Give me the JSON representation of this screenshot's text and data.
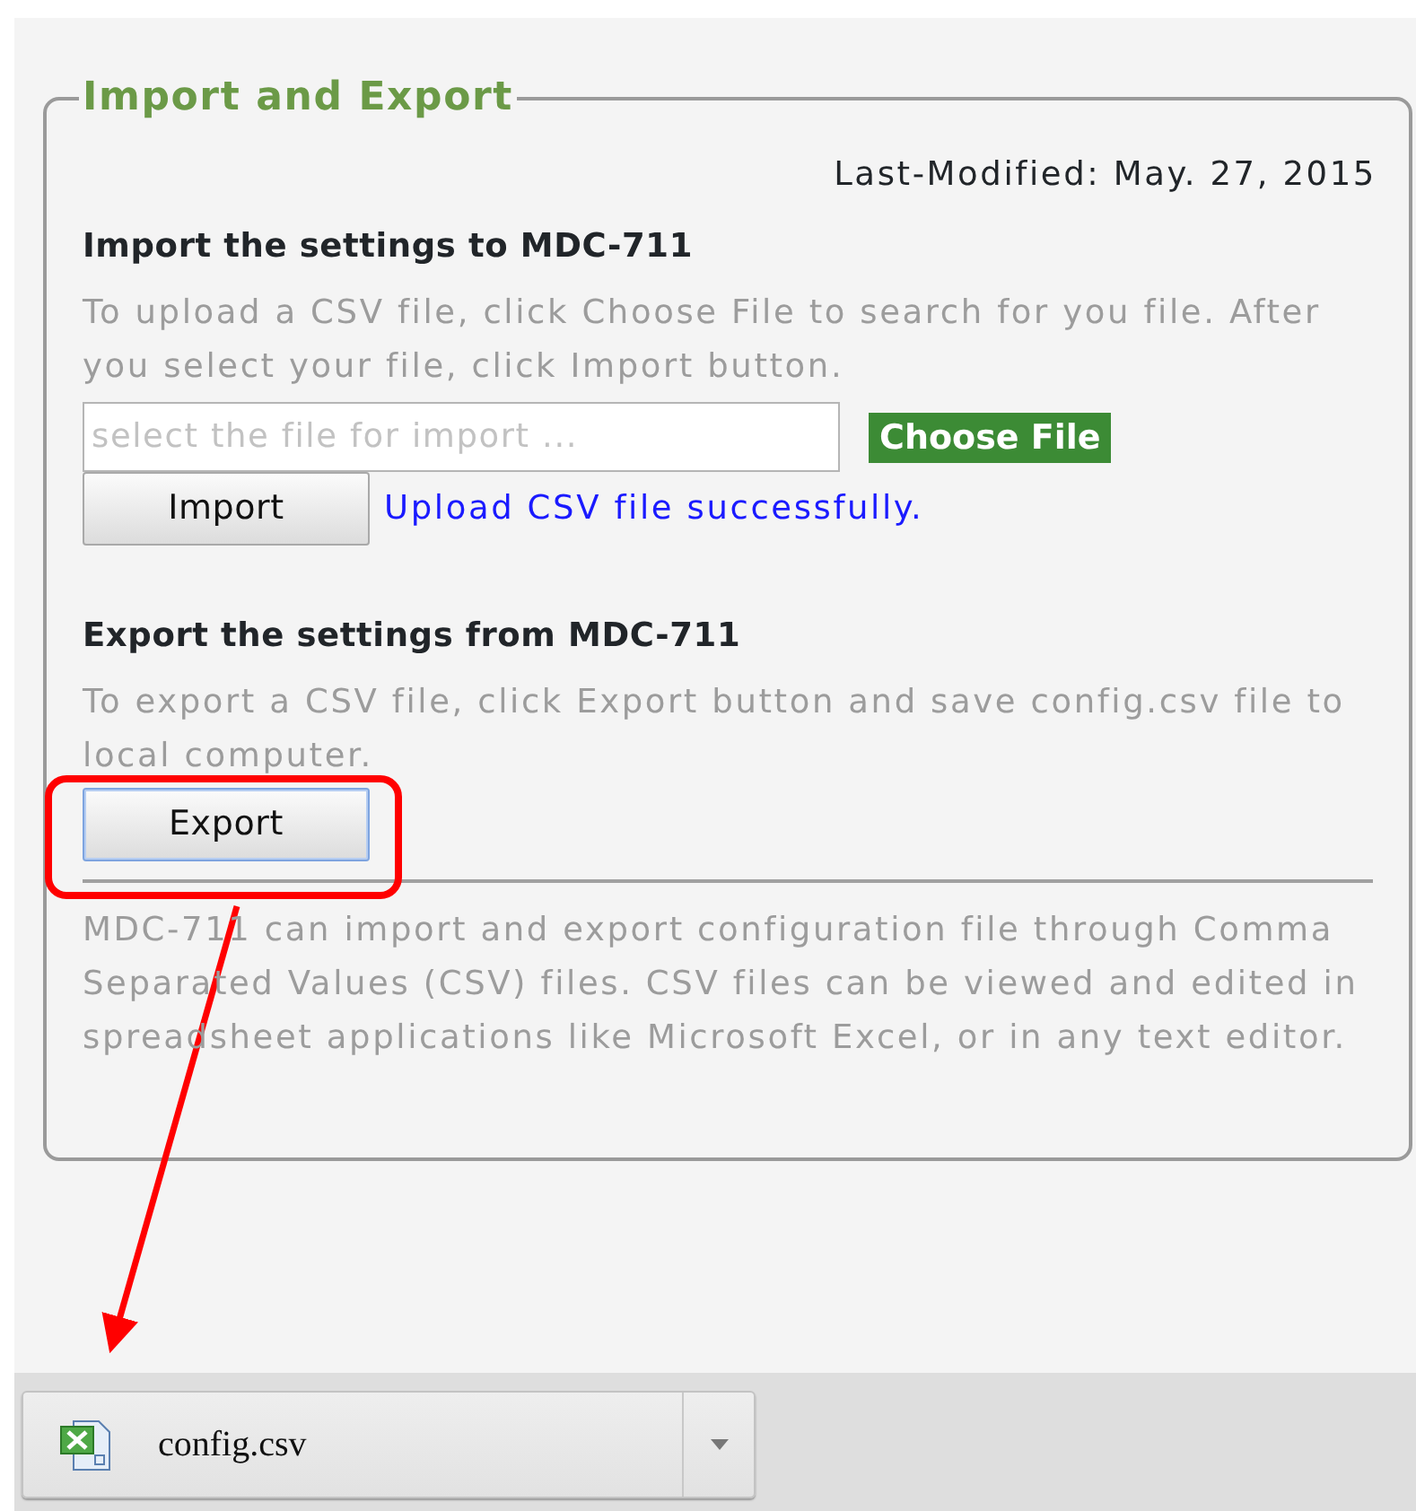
{
  "panel": {
    "title": "Import and Export",
    "last_modified": "Last-Modified: May. 27, 2015",
    "import": {
      "heading": "Import the settings to MDC-711",
      "description": "To upload a CSV file, click Choose File to search for you file. After you select your file, click Import button.",
      "file_field": {
        "placeholder": "select the file for import ..."
      },
      "choose_button": "Choose File",
      "import_button": "Import",
      "status": "Upload CSV file successfully."
    },
    "export": {
      "heading": "Export the settings from MDC-711",
      "description": "To export a CSV file, click Export button and save config.csv file to local computer.",
      "export_button": {
        "label": "Export",
        "focused": true
      }
    },
    "note": "MDC-711 can import and export configuration file through Comma Separated Values (CSV) files. CSV files can be viewed and edited in spreadsheet applications like Microsoft Excel, or in any text editor."
  },
  "download_bar": {
    "items": [
      {
        "file_name": "config.csv"
      }
    ]
  }
}
